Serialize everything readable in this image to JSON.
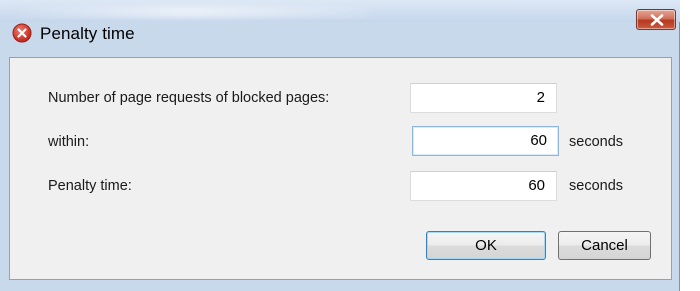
{
  "window": {
    "title": "Penalty time",
    "app_icon": "error-circle-icon",
    "close_icon": "close-icon"
  },
  "form": {
    "rows": [
      {
        "label": "Number of page requests of blocked pages:",
        "value": "2",
        "unit": ""
      },
      {
        "label": "within:",
        "value": "60",
        "unit": "seconds"
      },
      {
        "label": "Penalty time:",
        "value": "60",
        "unit": "seconds"
      }
    ]
  },
  "buttons": {
    "ok_label": "OK",
    "cancel_label": "Cancel"
  },
  "colors": {
    "window_frame": "#c9d9ec",
    "client_bg": "#f0f0f0",
    "close_button": "#c8503a",
    "app_icon": "#d9372b"
  }
}
